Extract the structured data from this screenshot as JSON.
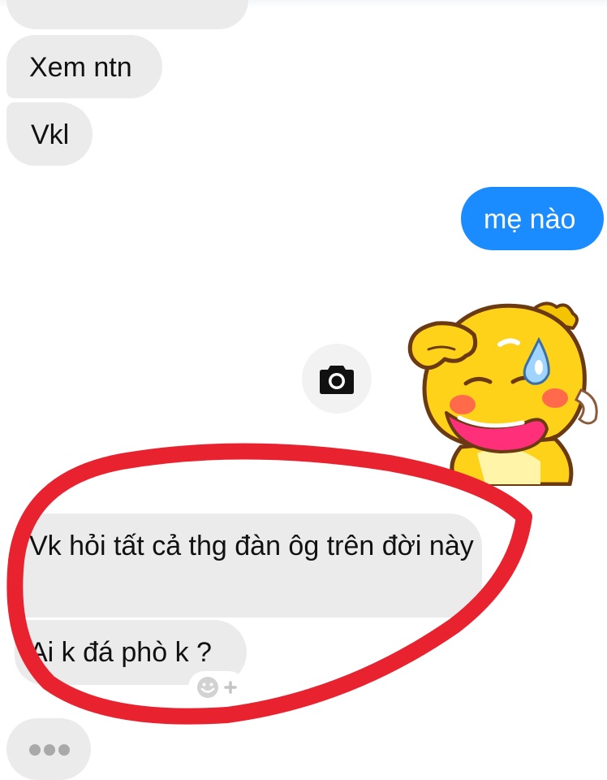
{
  "conversation": {
    "messages": [
      {
        "sender": "other",
        "text": "Xem ntn"
      },
      {
        "sender": "other",
        "text": "Vkl"
      },
      {
        "sender": "self",
        "text": "mẹ nào"
      },
      {
        "sender": "self",
        "type": "sticker",
        "sticker": "yellow-dragon-crying-sticker"
      },
      {
        "sender": "other",
        "text": "Vk hỏi tất cả thg đàn ôg trên đời này"
      },
      {
        "sender": "other",
        "text": "Ai k đá phò k ?"
      }
    ],
    "typing_indicator": {
      "visible": true
    }
  },
  "colors": {
    "outgoing_bubble": "#1a8cff",
    "incoming_bubble": "#ebebeb",
    "annotation_stroke": "#e8232f"
  },
  "icons": {
    "camera": "camera-icon",
    "reaction": "add-reaction-icon",
    "typing": "typing-dots-icon"
  }
}
